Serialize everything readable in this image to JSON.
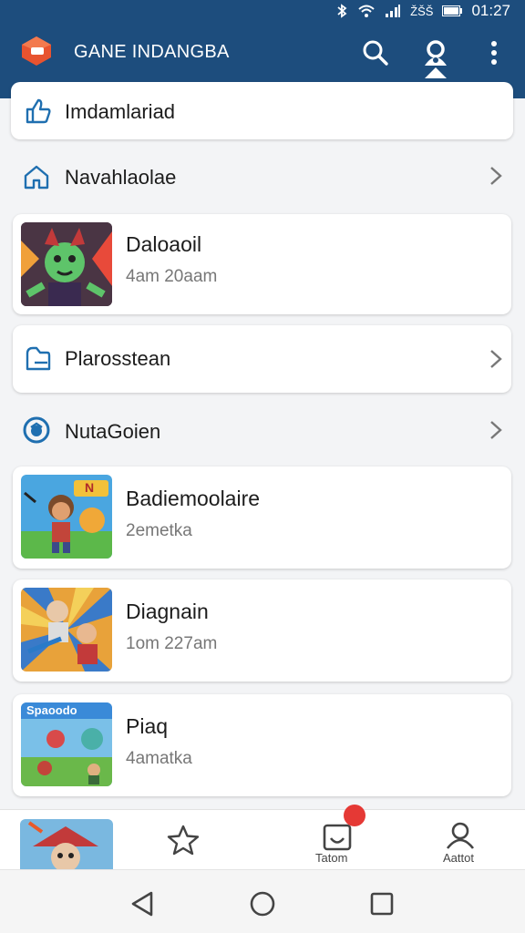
{
  "status_bar": {
    "time": "01:27",
    "carrier": "ŽŠŠ"
  },
  "app_bar": {
    "title": "GANE INDANGBA"
  },
  "menu": {
    "items": [
      {
        "label": "Imdamlariad"
      },
      {
        "label": "Navahlaolae"
      },
      {
        "label": "Plarosstean"
      },
      {
        "label": "NutaGoien"
      }
    ]
  },
  "games": [
    {
      "title": "Daloaoil",
      "subtitle": "4am 20aam"
    },
    {
      "title": "Badiemoolaire",
      "subtitle": "2emetka"
    },
    {
      "title": "Diagnain",
      "subtitle": "1om 227am"
    },
    {
      "title": "Piaq",
      "subtitle": "4amatka"
    }
  ],
  "thumb_text": {
    "badge2": "N",
    "badge4": "Spaoodo"
  },
  "bottom_nav": {
    "tab3_label": "Tatom",
    "tab4_label": "Aattot"
  },
  "colors": {
    "app_bar": "#1d4d7d",
    "accent_icon": "#1f6fb0",
    "badge": "#e53935",
    "logo": "#e8532f"
  }
}
